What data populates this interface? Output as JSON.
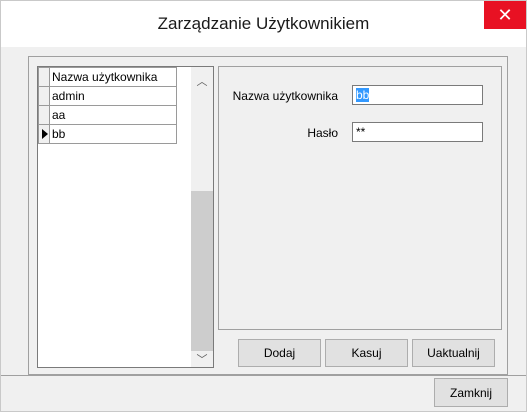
{
  "window": {
    "title": "Zarządzanie Użytkownikiem",
    "close_glyph": "✕"
  },
  "grid": {
    "column_header": "Nazwa użytkownika",
    "rows": [
      "admin",
      "aa",
      "bb"
    ],
    "selected_row": "bb",
    "scroll_up_glyph": "︿",
    "scroll_down_glyph": "﹀"
  },
  "form": {
    "username_label": "Nazwa użytkownika",
    "username_value": "bb",
    "password_label": "Hasło",
    "password_value": "**"
  },
  "buttons": {
    "add": "Dodaj",
    "delete": "Kasuj",
    "update": "Uaktualnij",
    "close": "Zamknij"
  },
  "colors": {
    "close_button": "#e81123",
    "selection": "#3399ff"
  }
}
